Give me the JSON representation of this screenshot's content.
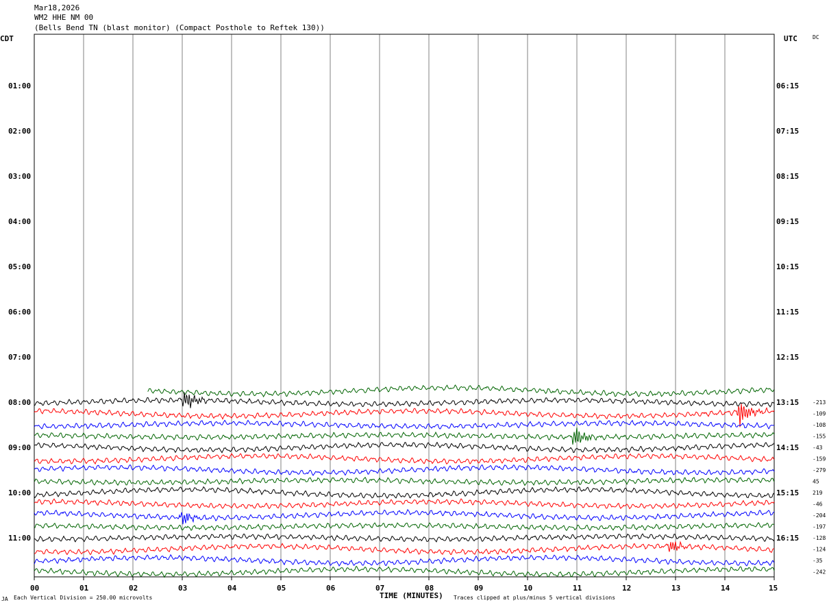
{
  "header": {
    "date": "Mar18,2026",
    "station": "WM2 HHE NM 00",
    "description": "(Bells Bend TN (blast monitor) (Compact Posthole to Reftek 130))"
  },
  "left_axis_title": "CDT",
  "right_axis_title": "UTC",
  "dc_label": "DC",
  "footer": {
    "division_note": "Each Vertical Division =  250.00 microvolts",
    "corner_mark": "JA",
    "clip_note": "Traces clipped at plus/minus 5 vertical divisions"
  },
  "chart_data": {
    "type": "line",
    "title": "",
    "xlabel": "TIME (MINUTES)",
    "x_ticks": [
      "00",
      "01",
      "02",
      "03",
      "04",
      "05",
      "06",
      "07",
      "08",
      "09",
      "10",
      "11",
      "12",
      "13",
      "14",
      "15"
    ],
    "xlim": [
      0,
      15
    ],
    "left_time_labels": [
      "01:00",
      "02:00",
      "03:00",
      "04:00",
      "05:00",
      "06:00",
      "07:00",
      "08:00",
      "09:00",
      "10:00",
      "11:00"
    ],
    "right_time_labels": [
      "06:15",
      "07:15",
      "08:15",
      "09:15",
      "10:15",
      "11:15",
      "12:15",
      "13:15",
      "14:15",
      "15:15",
      "16:15"
    ],
    "grid": "vertical lines at each minute",
    "trace_colors": [
      "#000000",
      "#ff0000",
      "#0000ff",
      "#006400"
    ],
    "traces": [
      {
        "row": -1,
        "color": "#006400",
        "start_minute": 2.3,
        "offset": null
      },
      {
        "row": 0,
        "color": "#000000",
        "start_minute": 0,
        "offset": "-213"
      },
      {
        "row": 1,
        "color": "#ff0000",
        "start_minute": 0,
        "offset": "-109"
      },
      {
        "row": 2,
        "color": "#0000ff",
        "start_minute": 0,
        "offset": "-108"
      },
      {
        "row": 3,
        "color": "#006400",
        "start_minute": 0,
        "offset": "-155"
      },
      {
        "row": 4,
        "color": "#000000",
        "start_minute": 0,
        "offset": "-43"
      },
      {
        "row": 5,
        "color": "#ff0000",
        "start_minute": 0,
        "offset": "-159"
      },
      {
        "row": 6,
        "color": "#0000ff",
        "start_minute": 0,
        "offset": "-279"
      },
      {
        "row": 7,
        "color": "#006400",
        "start_minute": 0,
        "offset": "45"
      },
      {
        "row": 8,
        "color": "#000000",
        "start_minute": 0,
        "offset": "219"
      },
      {
        "row": 9,
        "color": "#ff0000",
        "start_minute": 0,
        "offset": "-46"
      },
      {
        "row": 10,
        "color": "#0000ff",
        "start_minute": 0,
        "offset": "-204"
      },
      {
        "row": 11,
        "color": "#006400",
        "start_minute": 0,
        "offset": "-197"
      },
      {
        "row": 12,
        "color": "#000000",
        "start_minute": 0,
        "offset": "-128"
      },
      {
        "row": 13,
        "color": "#ff0000",
        "start_minute": 0,
        "offset": "-124"
      },
      {
        "row": 14,
        "color": "#0000ff",
        "start_minute": 0,
        "offset": "-35"
      },
      {
        "row": 15,
        "color": "#006400",
        "start_minute": 0,
        "offset": "-242"
      }
    ],
    "events": [
      {
        "row": 0,
        "minute": 3.05,
        "amplitude": 2.2
      },
      {
        "row": 1,
        "minute": 14.3,
        "amplitude": 2.6
      },
      {
        "row": 3,
        "minute": 10.95,
        "amplitude": 2.4
      },
      {
        "row": 10,
        "minute": 3.0,
        "amplitude": 1.5
      },
      {
        "row": 13,
        "minute": 12.9,
        "amplitude": 1.3
      }
    ]
  }
}
